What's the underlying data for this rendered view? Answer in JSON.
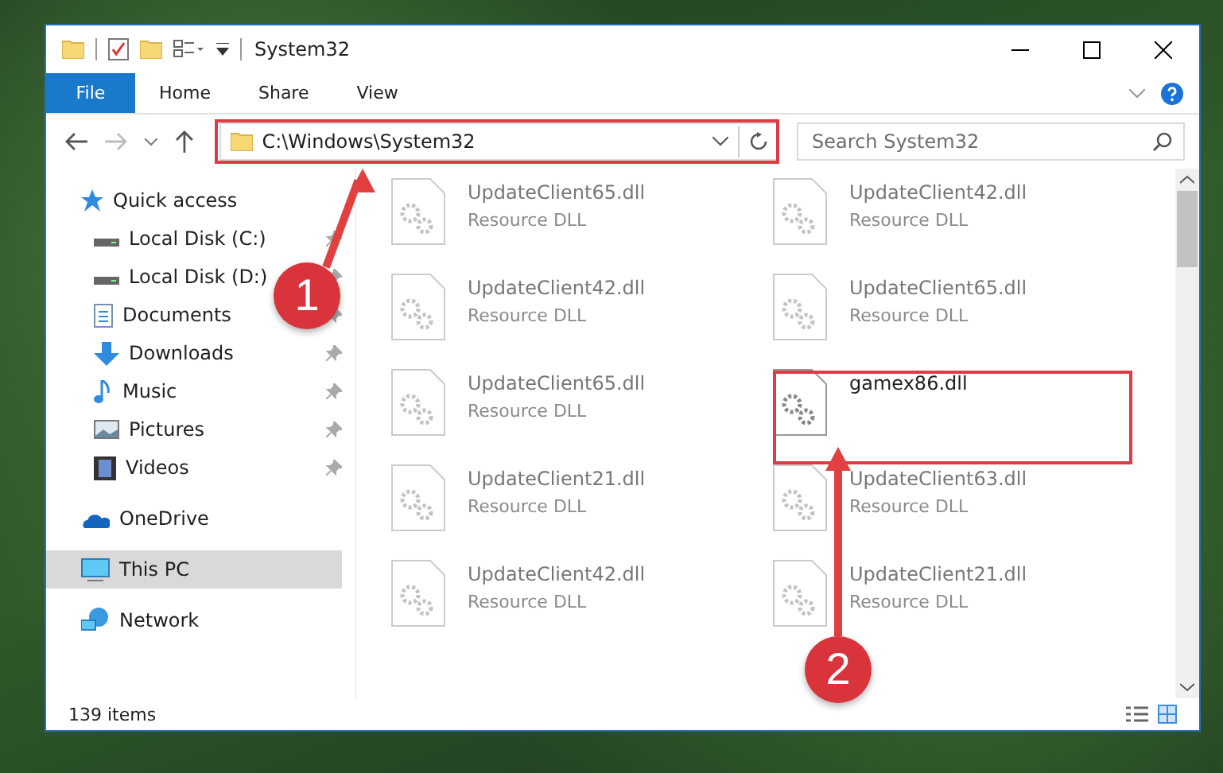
{
  "window": {
    "title": "System32"
  },
  "ribbon_tabs": [
    {
      "label": "File",
      "selected": true
    },
    {
      "label": "Home",
      "selected": false
    },
    {
      "label": "Share",
      "selected": false
    },
    {
      "label": "View",
      "selected": false
    }
  ],
  "address": {
    "path": "C:\\Windows\\System32"
  },
  "search": {
    "placeholder": "Search System32"
  },
  "sidebar": {
    "items": [
      {
        "label": "Quick access",
        "selected": false,
        "children": [
          {
            "label": "Local Disk (C:)",
            "pinned": true,
            "selected": false
          },
          {
            "label": "Local Disk (D:)",
            "pinned": true,
            "selected": false
          },
          {
            "label": "Documents",
            "pinned": true,
            "selected": false
          },
          {
            "label": "Downloads",
            "pinned": true,
            "selected": false
          },
          {
            "label": "Music",
            "pinned": true,
            "selected": false
          },
          {
            "label": "Pictures",
            "pinned": true,
            "selected": false
          },
          {
            "label": "Videos",
            "pinned": true,
            "selected": false
          }
        ]
      },
      {
        "label": "OneDrive",
        "selected": false
      },
      {
        "label": "This PC",
        "selected": true
      },
      {
        "label": "Network",
        "selected": false
      }
    ]
  },
  "files": [
    {
      "name": "UpdateClient65.dll",
      "type": "Resource DLL",
      "blurred": true
    },
    {
      "name": "UpdateClient42.dll",
      "type": "Resource DLL",
      "blurred": true
    },
    {
      "name": "UpdateClient42.dll",
      "type": "Resource DLL",
      "blurred": true
    },
    {
      "name": "UpdateClient65.dll",
      "type": "Resource DLL",
      "blurred": true
    },
    {
      "name": "UpdateClient65.dll",
      "type": "Resource DLL",
      "blurred": true
    },
    {
      "name": "gamex86.dll",
      "blurred": false
    },
    {
      "name": "UpdateClient21.dll",
      "type": "Resource DLL",
      "blurred": true
    },
    {
      "name": "UpdateClient63.dll",
      "type": "Resource DLL",
      "blurred": true
    },
    {
      "name": "UpdateClient42.dll",
      "type": "Resource DLL",
      "blurred": true
    },
    {
      "name": "UpdateClient21.dll",
      "type": "Resource DLL",
      "blurred": true
    }
  ],
  "status_bar": {
    "item_count": "139 items"
  },
  "annotations": [
    {
      "label": "1"
    },
    {
      "label": "2"
    }
  ]
}
